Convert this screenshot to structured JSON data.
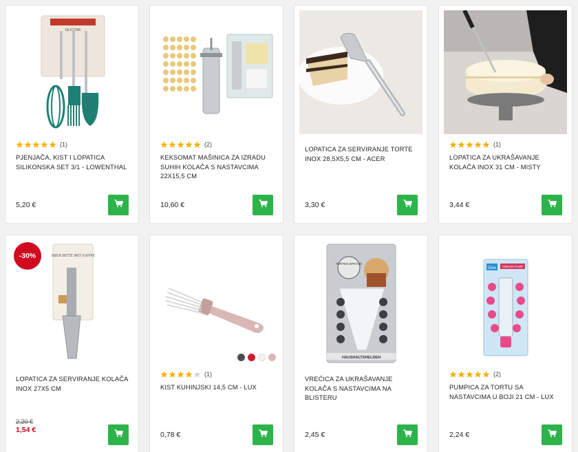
{
  "colors": {
    "accent": "#2db34a",
    "star": "#f5b301",
    "sale": "#d10a20"
  },
  "products": [
    {
      "title": "PJENJAČA, KIST I LOPATICA SILIKONSKA SET 3/1 - LOWENTHAL",
      "rating": 5,
      "reviews": "(1)",
      "price": "5,20 €"
    },
    {
      "title": "KEKSOMAT MAŠINICA ZA IZRADU SUHIH KOLAČA S NASTAVCIMA 22X15,5 CM",
      "rating": 5,
      "reviews": "(2)",
      "price": "10,60 €"
    },
    {
      "title": "LOPATICA ZA SERVIRANJE TORTE INOX 28,5X5,5 CM - ACER",
      "price": "3,30 €"
    },
    {
      "title": "LOPATICA ZA UKRAŠAVANJE KOLAČA INOX 31 CM - MISTY",
      "rating": 5,
      "reviews": "(1)",
      "price": "3,44 €"
    },
    {
      "title": "LOPATICA ZA SERVIRANJE KOLAČA INOX 27X5 CM",
      "badge": "-30%",
      "old_price": "2,20 €",
      "new_price": "1,54 €"
    },
    {
      "title": "KIST KUHINJSKI 14,5 CM - LUX",
      "rating": 4,
      "reviews": "(1)",
      "price": "0,78 €",
      "swatches": [
        "#4a4f57",
        "#c8202f",
        "#f3f3f3",
        "#d9b7b5"
      ]
    },
    {
      "title": "VREĆICA ZA UKRAŠAVANJE KOLAČA S NASTAVCIMA NA BLISTERU",
      "price": "2,45 €"
    },
    {
      "title": "PUMPICA ZA TORTU SA NASTAVCIMA U BOJI 21 CM - LUX",
      "rating": 5,
      "reviews": "(2)",
      "price": "2,24 €"
    }
  ],
  "package_text": {
    "silicone": "SILICONE",
    "pump_brand": "Glux",
    "pump_label": "CREAM PUMP",
    "piping_label": "TORTEN SPRITZE",
    "piping_brand": "HAUSHALTSHELDEN",
    "scraper_label": "ABER BITTE MIT SAHNE"
  }
}
